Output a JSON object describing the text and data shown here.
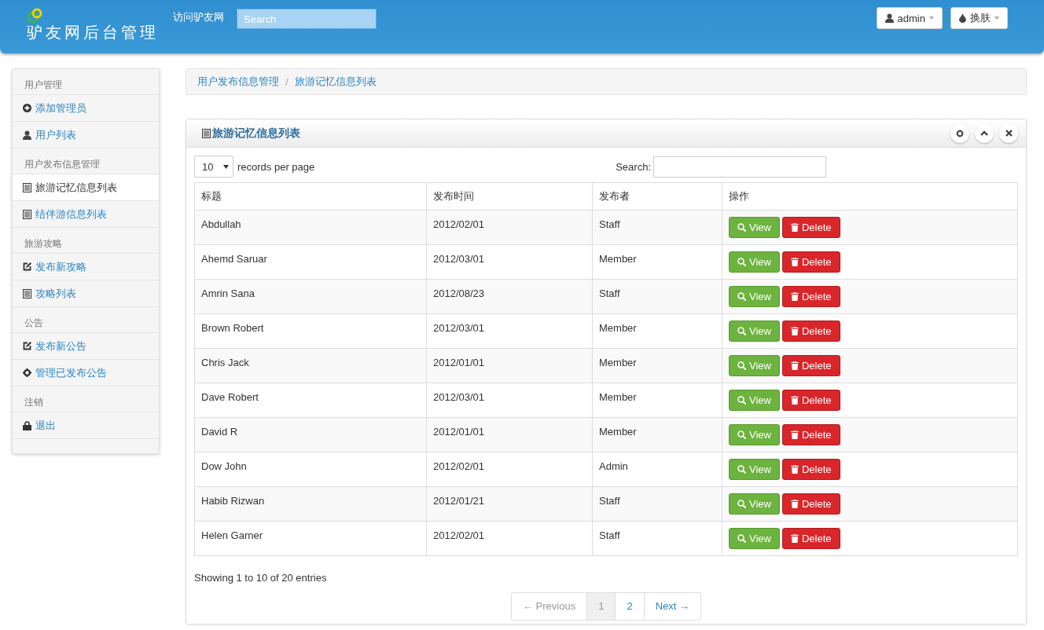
{
  "header": {
    "logo_text": "驴友网后台管理",
    "nav_link": "访问驴友网",
    "search": {
      "placeholder": "Search"
    },
    "buttons": [
      {
        "label": "admin",
        "kind": "user"
      },
      {
        "label": "换肤",
        "kind": "theme"
      }
    ]
  },
  "sidebar": {
    "items": [
      {
        "kind": "header",
        "label": "用户管理"
      },
      {
        "kind": "link",
        "label": "添加管理员",
        "selected": false
      },
      {
        "kind": "link",
        "label": "用户列表",
        "selected": false
      },
      {
        "kind": "header",
        "label": "用户发布信息管理"
      },
      {
        "kind": "link",
        "label": "旅游记忆信息列表",
        "selected": true
      },
      {
        "kind": "link",
        "label": "结伴游信息列表",
        "selected": false
      },
      {
        "kind": "header",
        "label": "旅游攻略"
      },
      {
        "kind": "link",
        "label": "发布新攻略",
        "selected": false
      },
      {
        "kind": "link",
        "label": "攻略列表",
        "selected": false
      },
      {
        "kind": "header",
        "label": "公告"
      },
      {
        "kind": "link",
        "label": "发布新公告",
        "selected": false
      },
      {
        "kind": "link",
        "label": "管理已发布公告",
        "selected": false
      },
      {
        "kind": "header",
        "label": "注销"
      },
      {
        "kind": "link",
        "label": "退出",
        "selected": false
      }
    ]
  },
  "breadcrumb": {
    "items": [
      "用户发布信息管理",
      "旅游记忆信息列表"
    ],
    "separator": "/"
  },
  "panel": {
    "title": "旅游记忆信息列表",
    "page_size": "10",
    "page_size_label": "records per page",
    "search_label": "Search:",
    "table": {
      "columns": [
        "标题",
        "发布时间",
        "发布者",
        "操作"
      ],
      "rows": [
        {
          "title": "Abdullah",
          "date": "2012/02/01",
          "author": "Staff",
          "view_label": "View",
          "delete_label": "Delete"
        },
        {
          "title": "Ahemd Saruar",
          "date": "2012/03/01",
          "author": "Member",
          "view_label": "View",
          "delete_label": "Delete"
        },
        {
          "title": "Amrin Sana",
          "date": "2012/08/23",
          "author": "Staff",
          "view_label": "View",
          "delete_label": "Delete"
        },
        {
          "title": "Brown Robert",
          "date": "2012/03/01",
          "author": "Member",
          "view_label": "View",
          "delete_label": "Delete"
        },
        {
          "title": "Chris Jack",
          "date": "2012/01/01",
          "author": "Member",
          "view_label": "View",
          "delete_label": "Delete"
        },
        {
          "title": "Dave Robert",
          "date": "2012/03/01",
          "author": "Member",
          "view_label": "View",
          "delete_label": "Delete"
        },
        {
          "title": "David R",
          "date": "2012/01/01",
          "author": "Member",
          "view_label": "View",
          "delete_label": "Delete"
        },
        {
          "title": "Dow John",
          "date": "2012/02/01",
          "author": "Admin",
          "view_label": "View",
          "delete_label": "Delete"
        },
        {
          "title": "Habib Rizwan",
          "date": "2012/01/21",
          "author": "Staff",
          "view_label": "View",
          "delete_label": "Delete"
        },
        {
          "title": "Helen Garner",
          "date": "2012/02/01",
          "author": "Staff",
          "view_label": "View",
          "delete_label": "Delete"
        }
      ]
    },
    "info": "Showing 1 to 10 of 20 entries",
    "pagination": [
      {
        "label": "← Previous",
        "disabled": true,
        "selected": false
      },
      {
        "label": "1",
        "disabled": false,
        "selected": true
      },
      {
        "label": "2",
        "disabled": false,
        "selected": false
      },
      {
        "label": "Next →",
        "disabled": false,
        "selected": false
      }
    ]
  }
}
